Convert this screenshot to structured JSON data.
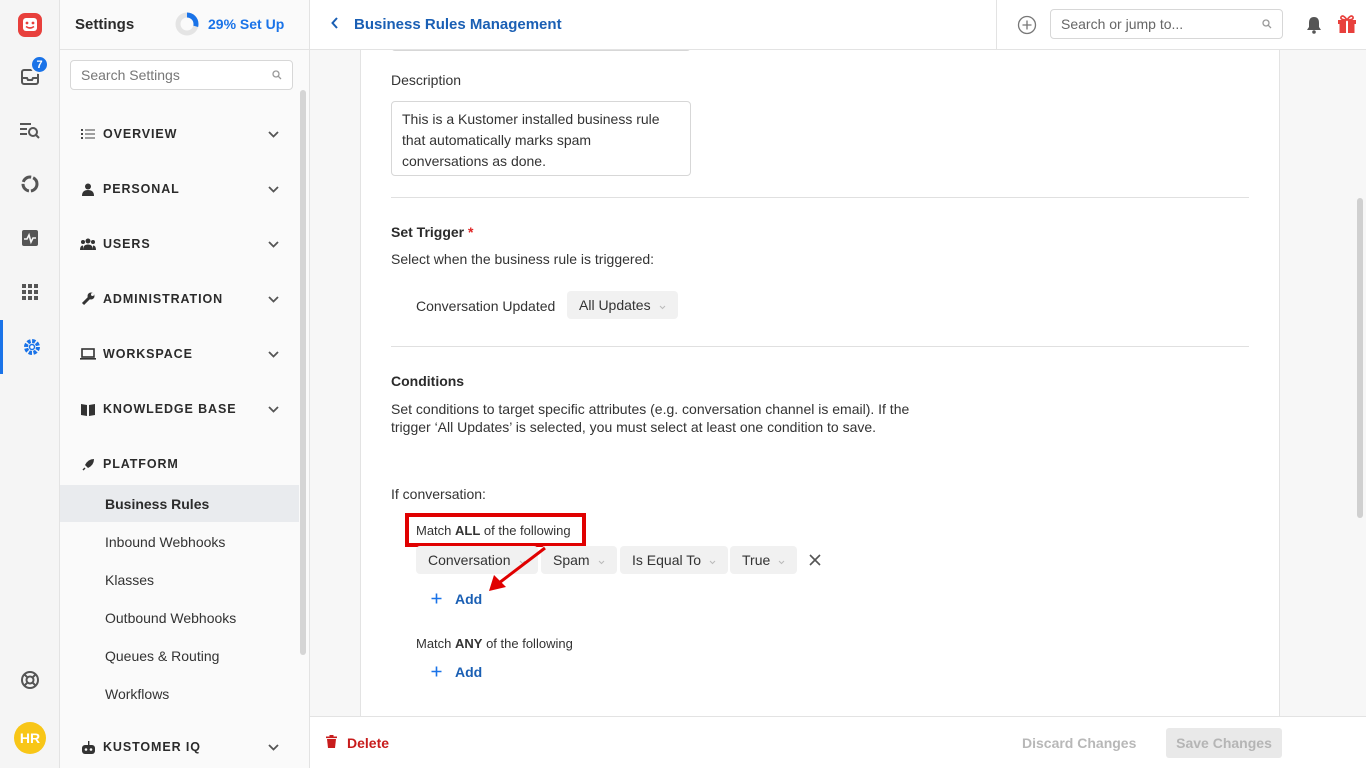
{
  "rail": {
    "inbox_badge": "7",
    "avatar_initials": "HR"
  },
  "settings": {
    "title": "Settings",
    "setup_progress_text": "29% Set Up",
    "setup_progress": 0.29,
    "search_placeholder": "Search Settings",
    "sections": [
      {
        "label": "OVERVIEW"
      },
      {
        "label": "PERSONAL"
      },
      {
        "label": "USERS"
      },
      {
        "label": "ADMINISTRATION"
      },
      {
        "label": "WORKSPACE"
      },
      {
        "label": "KNOWLEDGE BASE"
      },
      {
        "label": "PLATFORM"
      },
      {
        "label": "KUSTOMER IQ"
      }
    ],
    "platform_items": [
      {
        "label": "Business Rules",
        "active": true
      },
      {
        "label": "Inbound Webhooks"
      },
      {
        "label": "Klasses"
      },
      {
        "label": "Outbound Webhooks"
      },
      {
        "label": "Queues & Routing"
      },
      {
        "label": "Workflows"
      }
    ]
  },
  "topbar": {
    "page_title": "Business Rules Management",
    "search_placeholder": "Search or jump to..."
  },
  "form": {
    "description_label": "Description",
    "description_value": "This is a Kustomer installed business rule that automatically marks spam conversations as done.",
    "trigger_heading": "Set Trigger",
    "trigger_required": "*",
    "trigger_help": "Select when the business rule is triggered:",
    "trigger_event": "Conversation Updated",
    "trigger_option": "All Updates",
    "conditions_heading": "Conditions",
    "conditions_help_1": "Set conditions to target specific attributes (e.g. conversation channel is email). If the",
    "conditions_help_2": "trigger ‘All Updates’ is selected, you must select at least one condition to save.",
    "if_conversation": "If conversation:",
    "match_all": {
      "prefix": "Match ",
      "keyword": "ALL",
      "suffix": " of the following"
    },
    "condition_row": {
      "object": "Conversation",
      "attribute": "Spam",
      "operator": "Is Equal To",
      "value": "True"
    },
    "add_label": "Add",
    "match_any": {
      "prefix": "Match ",
      "keyword": "ANY",
      "suffix": " of the following"
    },
    "add_label_2": "Add"
  },
  "footer": {
    "delete_label": "Delete",
    "discard_label": "Discard Changes",
    "save_label": "Save Changes"
  },
  "colors": {
    "accent": "#1a73e8",
    "link": "#1a5fb4",
    "danger": "#c81c1c",
    "annotation_red": "#e00000"
  }
}
